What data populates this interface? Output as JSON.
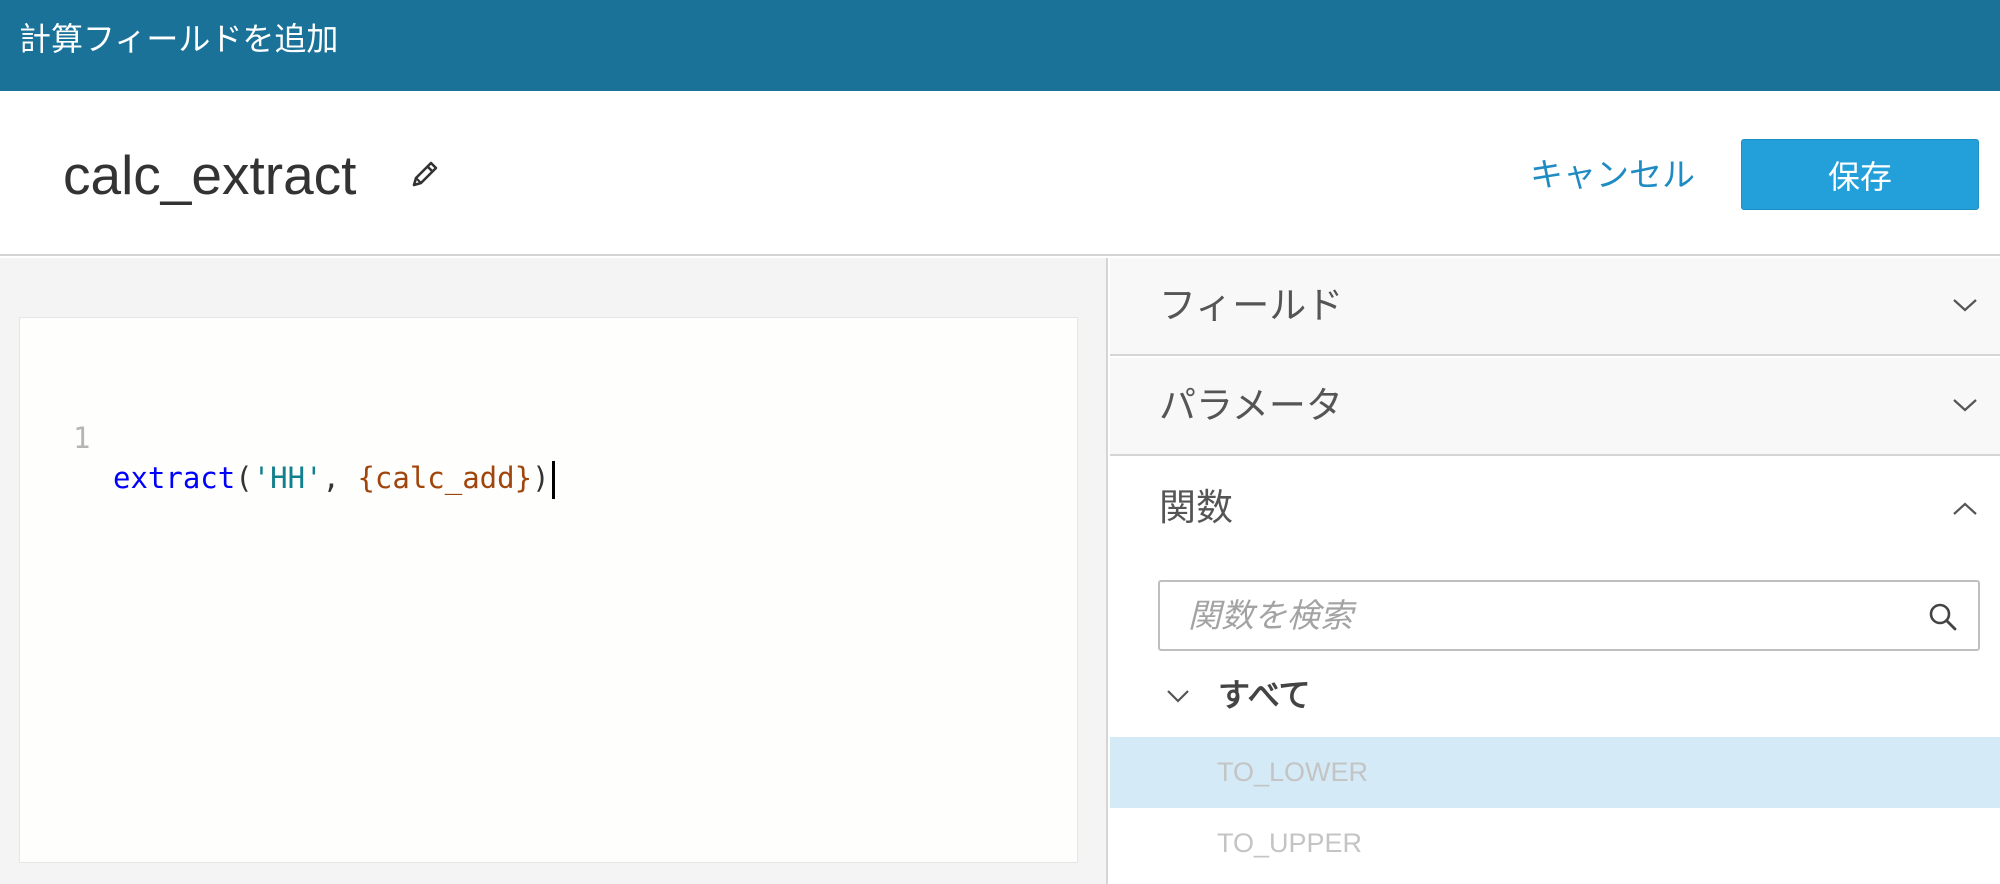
{
  "window": {
    "title": "計算フィールドを追加"
  },
  "header": {
    "field_name": "calc_extract",
    "cancel_label": "キャンセル",
    "save_label": "保存"
  },
  "editor": {
    "line_number": "1",
    "tokens": {
      "fn": "extract",
      "open": "(",
      "str": "'HH'",
      "sep": ", ",
      "field": "{calc_add}",
      "close": ")"
    }
  },
  "panel": {
    "fields_label": "フィールド",
    "parameters_label": "パラメータ",
    "functions_label": "関数",
    "search": {
      "placeholder": "関数を検索",
      "value": ""
    },
    "category_label": "すべて",
    "functions": [
      "TO_LOWER",
      "TO_UPPER"
    ],
    "selected_function": "TO_LOWER"
  },
  "colors": {
    "titlebar": "#1a7299",
    "accent": "#23a0d9",
    "link": "#1e8bc3",
    "selected_row": "#d4eaf7",
    "code_function": "#0000ff",
    "code_string": "#117f8c",
    "code_field": "#a0460c"
  },
  "icons": [
    "pencil-icon",
    "chevron-down-icon",
    "chevron-up-icon",
    "search-icon"
  ]
}
